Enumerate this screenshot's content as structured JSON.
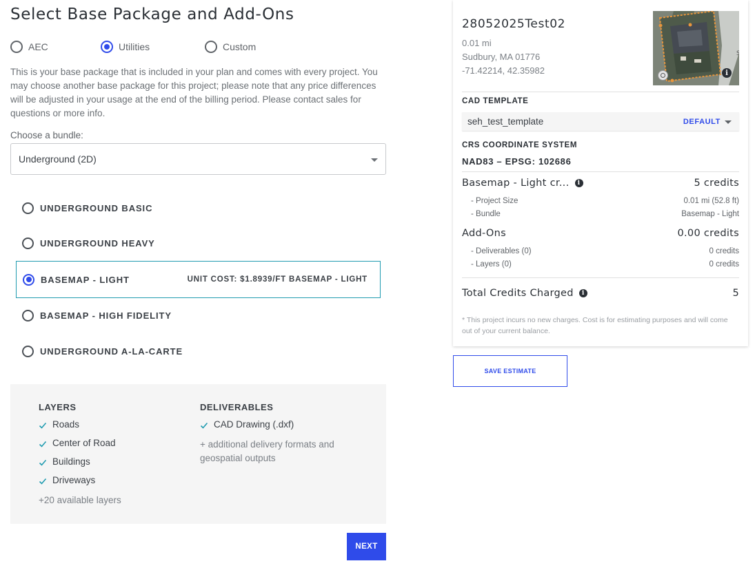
{
  "page_title": "Select Base Package and Add-Ons",
  "packages": [
    {
      "label": "AEC",
      "checked": false
    },
    {
      "label": "Utilities",
      "checked": true
    },
    {
      "label": "Custom",
      "checked": false
    }
  ],
  "description": "This is your base package that is included in your plan and comes with every project. You may choose another base package for this project; please note that any price differences will be adjusted in your usage at the end of the billing period. Please contact sales for questions or more info.",
  "bundle": {
    "label": "Choose a bundle:",
    "selected": "Underground (2D)"
  },
  "options": [
    {
      "label": "UNDERGROUND BASIC",
      "checked": false
    },
    {
      "label": "UNDERGROUND HEAVY",
      "checked": false
    },
    {
      "label": "BASEMAP - LIGHT",
      "checked": true,
      "unit_cost": "UNIT COST: $1.8939/FT BASEMAP - LIGHT"
    },
    {
      "label": "BASEMAP - HIGH FIDELITY",
      "checked": false
    },
    {
      "label": "UNDERGROUND A-LA-CARTE",
      "checked": false
    }
  ],
  "features": {
    "layers_heading": "LAYERS",
    "layers": [
      "Roads",
      "Center of Road",
      "Buildings",
      "Driveways"
    ],
    "layers_more": "+20 available layers",
    "deliverables_heading": "DELIVERABLES",
    "deliverables": [
      "CAD Drawing (.dxf)"
    ],
    "deliverables_more": "+ additional delivery formats and geospatial outputs"
  },
  "next_label": "NEXT",
  "project": {
    "name": "28052025Test02",
    "distance": "0.01 mi",
    "location": "Sudbury, MA 01776",
    "coords": "-71.42214, 42.35982"
  },
  "cad_template": {
    "heading": "CAD TEMPLATE",
    "name": "seh_test_template",
    "tag": "DEFAULT"
  },
  "crs": {
    "heading": "CRS COORDINATE SYSTEM",
    "value": "NAD83 – EPSG: 102686"
  },
  "summary": {
    "bundle_title": "Basemap - Light cr...",
    "bundle_credits": "5 credits",
    "project_size_label": "- Project Size",
    "project_size_value": "0.01 mi (52.8 ft)",
    "bundle_label": "- Bundle",
    "bundle_value": "Basemap - Light",
    "addons_title": "Add-Ons",
    "addons_credits": "0.00 credits",
    "deliverables_label": "- Deliverables (0)",
    "deliverables_value": "0 credits",
    "layers_label": "- Layers (0)",
    "layers_value": "0 credits",
    "total_label": "Total Credits Charged",
    "total_value": "5",
    "note": "* This project incurs no new charges. Cost is for estimating purposes and will come out of your current balance."
  },
  "save_label": "SAVE ESTIMATE",
  "colors": {
    "accent": "#2f4bea",
    "selected_border": "#1f9bb0",
    "check": "#1f9bb0",
    "panel_bg": "#f5f5f5"
  },
  "icons": [
    "radio-icon",
    "caret-down-icon",
    "check-icon",
    "info-icon",
    "map-compass-icon"
  ]
}
